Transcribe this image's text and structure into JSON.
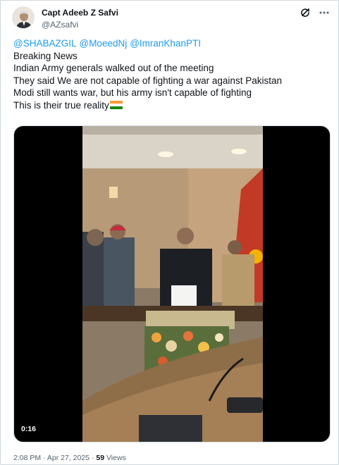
{
  "author": {
    "display_name": "Capt Adeeb Z Safvi",
    "handle": "@AZsafvi"
  },
  "icons": {
    "grok": "grok-icon",
    "more": "more-icon"
  },
  "tweet": {
    "mentions": [
      "@SHABAZGIL",
      "@MoeedNj",
      "@ImranKhanPTI"
    ],
    "lines": [
      "Breaking News",
      "Indian Army generals walked out of the meeting",
      "They said We are not capable of fighting a war against Pakistan",
      "Modi still wants war, but his army isn't capable of fighting",
      "This is their true reality"
    ],
    "flag_emoji": "india-flag"
  },
  "video": {
    "duration": "0:16"
  },
  "meta": {
    "time": "2:08 PM",
    "separator": "·",
    "date": "Apr 27, 2025",
    "views_count": "59",
    "views_label": "Views"
  },
  "colors": {
    "link": "#1d9bf0",
    "secondary_text": "#536471",
    "primary_text": "#0f1419",
    "border": "#cfd9de"
  }
}
